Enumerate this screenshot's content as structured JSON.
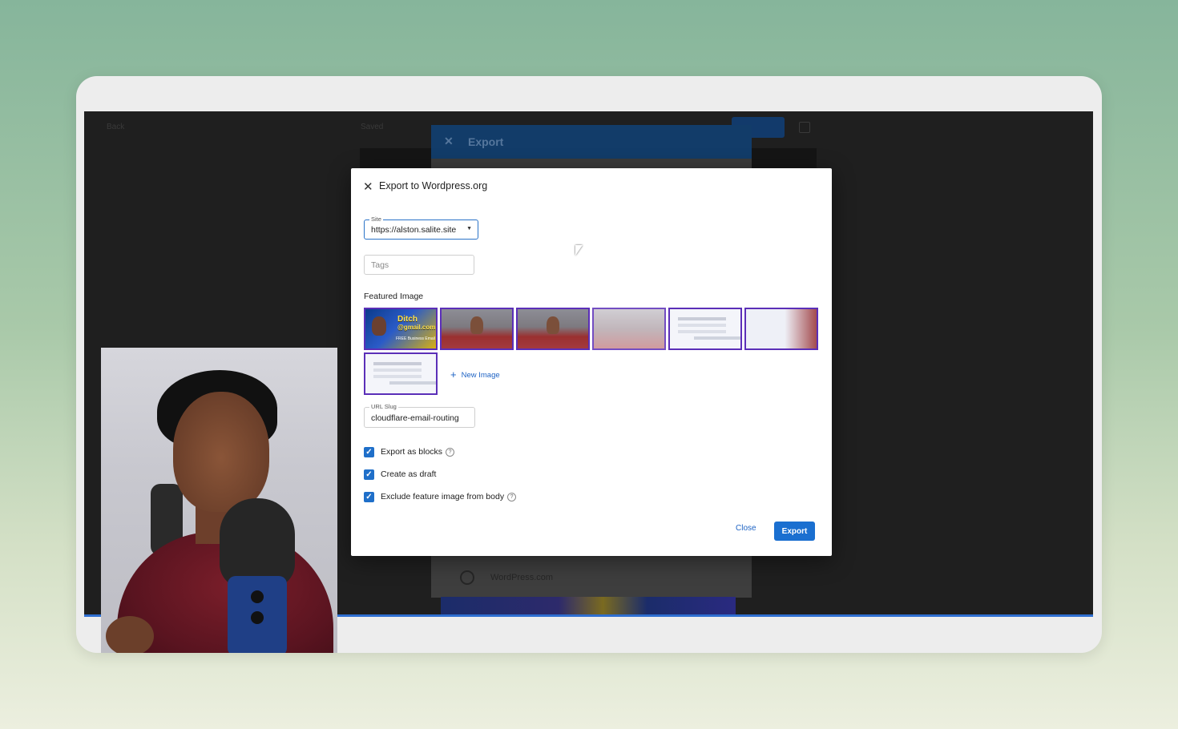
{
  "background_app": {
    "topbar_left": "Back",
    "topbar_mid": "Saved",
    "panel_title": "Export",
    "panel_row_label": "WordPress.com"
  },
  "modal": {
    "title": "Export to Wordpress.org",
    "site": {
      "label": "Site",
      "value": "https://alston.salite.site"
    },
    "tags": {
      "placeholder": "Tags",
      "value": ""
    },
    "featured_image": {
      "label": "Featured Image",
      "thumbnails": [
        {
          "kind": "brand-thumbnail",
          "text_line1": "Ditch",
          "text_line2": "@gmail.com",
          "text_line3": "FREE Business Email"
        },
        {
          "kind": "video-frame"
        },
        {
          "kind": "video-frame"
        },
        {
          "kind": "video-frame-faded"
        },
        {
          "kind": "screenshot"
        },
        {
          "kind": "screenshot-with-video"
        },
        {
          "kind": "screenshot"
        }
      ],
      "new_image_label": "New Image"
    },
    "url_slug": {
      "label": "URL Slug",
      "value": "cloudflare-email-routing"
    },
    "options": [
      {
        "label": "Export as blocks",
        "checked": true,
        "help": true
      },
      {
        "label": "Create as draft",
        "checked": true,
        "help": false
      },
      {
        "label": "Exclude feature image from body",
        "checked": true,
        "help": true
      }
    ],
    "close_label": "Close",
    "export_label": "Export"
  },
  "colors": {
    "accent": "#1a6fd0",
    "thumb_border": "#5b2fb8",
    "checkbox": "#1f6fc9"
  }
}
